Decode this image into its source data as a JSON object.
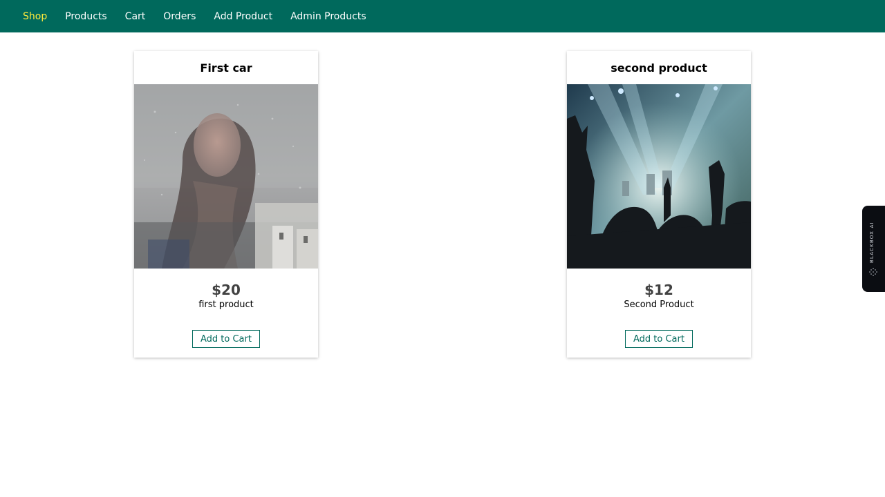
{
  "nav": {
    "items": [
      {
        "label": "Shop",
        "active": true
      },
      {
        "label": "Products",
        "active": false
      },
      {
        "label": "Cart",
        "active": false
      },
      {
        "label": "Orders",
        "active": false
      },
      {
        "label": "Add Product",
        "active": false
      },
      {
        "label": "Admin Products",
        "active": false
      }
    ]
  },
  "products": [
    {
      "title": "First car",
      "price": "$20",
      "description": "first product",
      "button_label": "Add to Cart"
    },
    {
      "title": "second product",
      "price": "$12",
      "description": "Second Product",
      "button_label": "Add to Cart"
    }
  ],
  "side_widget": {
    "label": "BLACKBOX AI"
  },
  "colors": {
    "header_bg": "#00695c",
    "active_nav": "#ffeb3b",
    "accent": "#00695c"
  }
}
